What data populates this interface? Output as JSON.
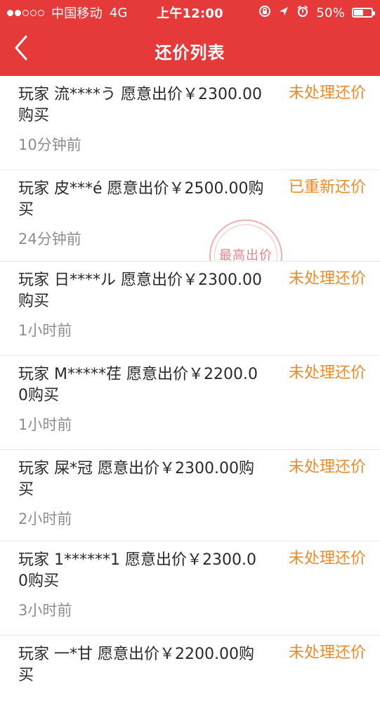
{
  "status_bar": {
    "carrier": "中国移动",
    "network": "4G",
    "time": "上午12:00",
    "battery_percent": "50%",
    "battery_level": 0.5,
    "icons": [
      "rotation-lock-icon",
      "location-arrow-icon",
      "alarm-icon",
      "battery-icon"
    ]
  },
  "nav": {
    "title": "还价列表",
    "back_icon": "chevron-left-icon"
  },
  "colors": {
    "header_bg": "#e63a3a",
    "status_text": "#f08a24",
    "time_text": "#8d8d8d",
    "divider": "#e7e7e7"
  },
  "list": {
    "items": [
      {
        "offer_text": "玩家 流****う 愿意出价￥2300.00购买",
        "status": "未处理还价",
        "time": "10分钟前"
      },
      {
        "offer_text": "玩家 皮***é 愿意出价￥2500.00购买",
        "status": "已重新还价",
        "time": "24分钟前",
        "stamp": "最高出价"
      },
      {
        "offer_text": "玩家 日****ル 愿意出价￥2300.00购买",
        "status": "未处理还价",
        "time": "1小时前"
      },
      {
        "offer_text": "玩家 M*****荏 愿意出价￥2200.00购买",
        "status": "未处理还价",
        "time": "1小时前"
      },
      {
        "offer_text": "玩家 屎*冠 愿意出价￥2300.00购买",
        "status": "未处理还价",
        "time": "2小时前"
      },
      {
        "offer_text": "玩家 1******1 愿意出价￥2300.00购买",
        "status": "未处理还价",
        "time": "3小时前"
      },
      {
        "offer_text": "玩家 一*甘 愿意出价￥2200.00购买",
        "status": "未处理还价",
        "time": ""
      }
    ]
  }
}
